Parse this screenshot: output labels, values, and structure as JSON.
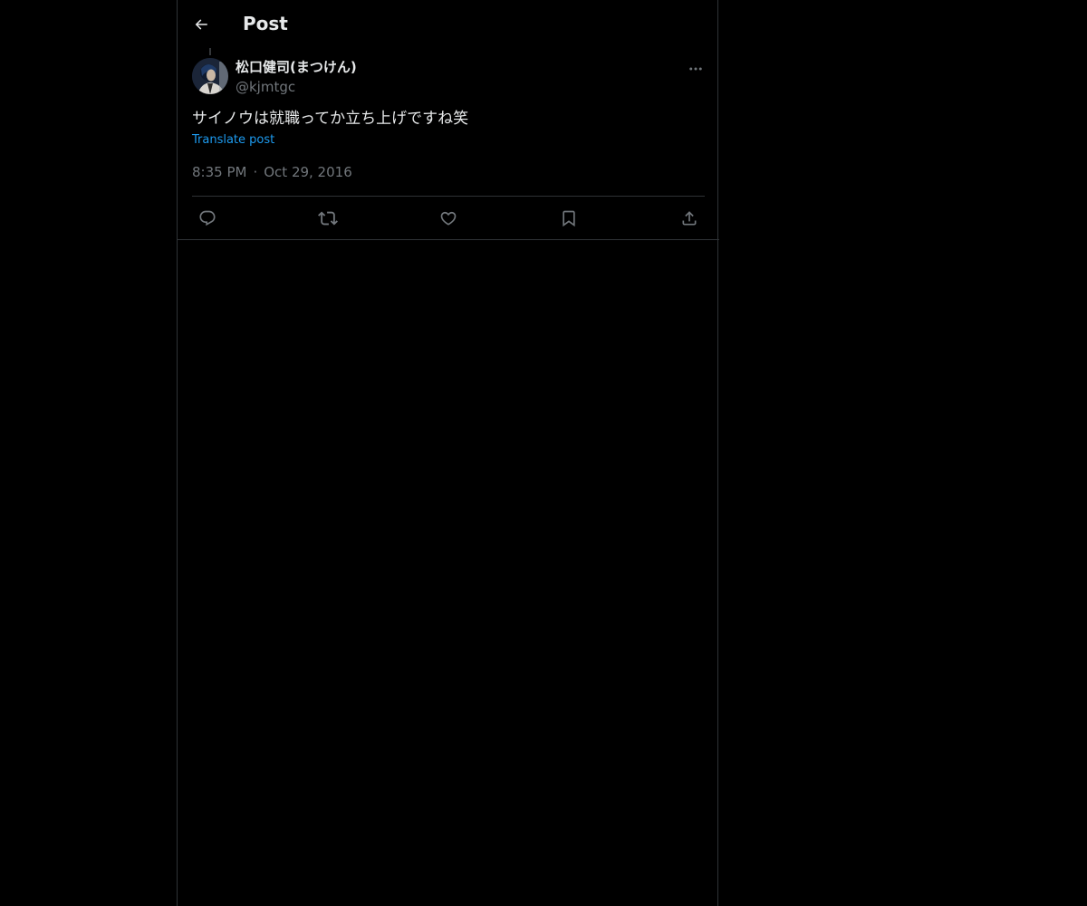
{
  "header": {
    "title": "Post",
    "back_icon": "arrow-left-icon"
  },
  "post": {
    "author": {
      "display_name": "松口健司(まつけん)",
      "handle": "@kjmtgc"
    },
    "text": "サイノウは就職ってか立ち上げですね笑",
    "translate_label": "Translate post",
    "time": "8:35 PM",
    "separator": "·",
    "date": "Oct 29, 2016",
    "more_icon": "more-dots-icon",
    "actions": [
      {
        "name": "reply",
        "icon": "reply-icon"
      },
      {
        "name": "repost",
        "icon": "repost-icon"
      },
      {
        "name": "like",
        "icon": "heart-icon"
      },
      {
        "name": "bookmark",
        "icon": "bookmark-icon"
      },
      {
        "name": "share",
        "icon": "share-icon"
      }
    ]
  },
  "colors": {
    "background": "#000000",
    "text": "#e7e9ea",
    "secondary": "#71767b",
    "accent": "#1d9bf0",
    "border": "#2f3336"
  }
}
